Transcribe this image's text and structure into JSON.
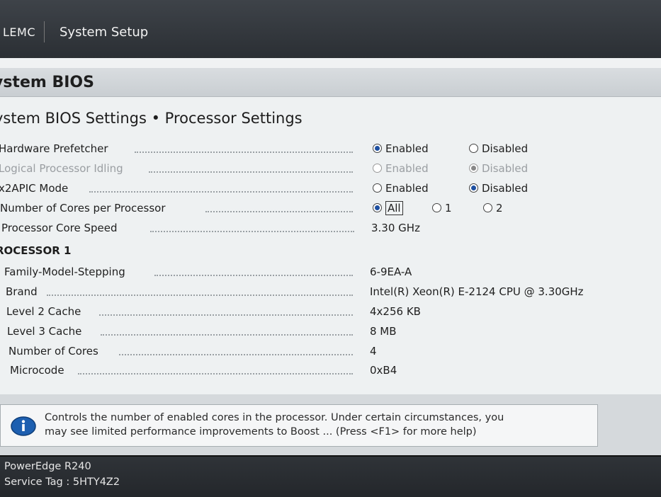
{
  "header": {
    "brand": "LEMC",
    "app_title": "System Setup"
  },
  "section_title": "ystem BIOS",
  "breadcrumb": "ystem BIOS Settings • Processor Settings",
  "settings": [
    {
      "label": "Hardware Prefetcher",
      "options": [
        "Enabled",
        "Disabled"
      ],
      "selected": "Enabled"
    },
    {
      "label": "Logical Processor Idling",
      "options": [
        "Enabled",
        "Disabled"
      ],
      "selected": "Disabled",
      "disabled": true
    },
    {
      "label": "x2APIC Mode",
      "options": [
        "Enabled",
        "Disabled"
      ],
      "selected": "Disabled"
    },
    {
      "label": "Number of Cores per Processor",
      "options": [
        "All",
        "1",
        "2"
      ],
      "selected": "All"
    },
    {
      "label": "Processor Core Speed",
      "value": "3.30 GHz"
    }
  ],
  "processor": {
    "heading": "ROCESSOR 1",
    "rows": [
      {
        "label": "Family-Model-Stepping",
        "value": "6-9EA-A"
      },
      {
        "label": "Brand",
        "value": "Intel(R) Xeon(R) E-2124 CPU @ 3.30GHz"
      },
      {
        "label": "Level 2 Cache",
        "value": "4x256 KB"
      },
      {
        "label": "Level 3 Cache",
        "value": "8 MB"
      },
      {
        "label": "Number of Cores",
        "value": "4"
      },
      {
        "label": "Microcode",
        "value": "0xB4"
      }
    ]
  },
  "help": {
    "line1": "Controls the number of enabled cores in the processor. Under certain circumstances, you",
    "line2": "may see limited performance improvements to Boost ... (Press <F1> for more help)"
  },
  "footer": {
    "model": "PowerEdge R240",
    "service_tag": "Service Tag : 5HTY4Z2"
  },
  "colors": {
    "accent": "#1d4fa0",
    "topbar": "#2b2f34"
  }
}
